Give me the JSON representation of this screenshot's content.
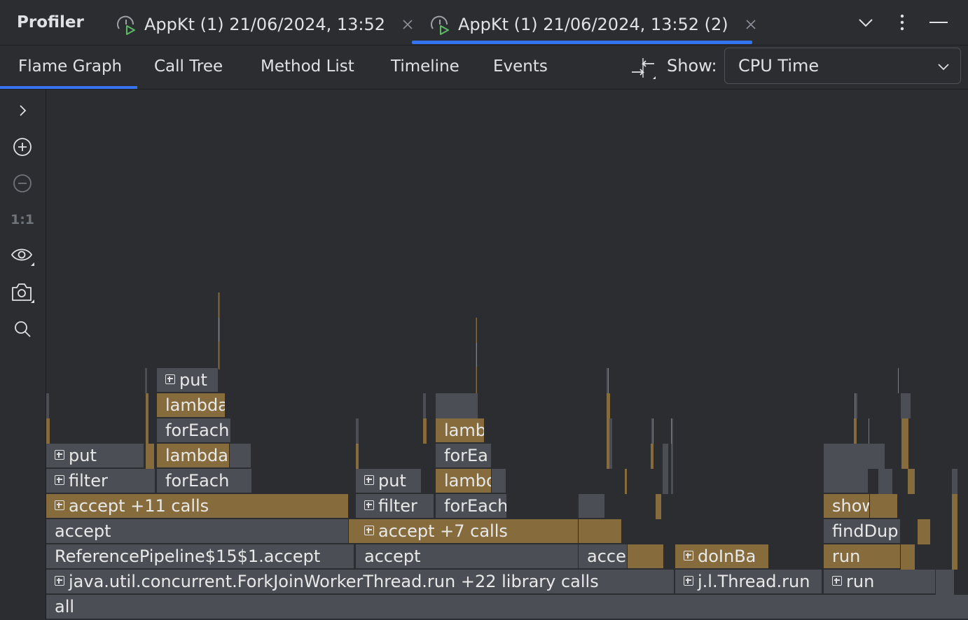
{
  "app_title": "Profiler",
  "tabs": [
    {
      "label": "AppKt (1) 21/06/2024, 13:52",
      "active": false,
      "icon": "profiler-snapshot-icon"
    },
    {
      "label": "AppKt (1) 21/06/2024, 13:52 (2)",
      "active": true,
      "icon": "profiler-snapshot-icon"
    }
  ],
  "window_controls": {
    "dropdown_icon": "chevron-down-icon",
    "more_icon": "more-vertical-icon",
    "minimize_icon": "minimize-icon"
  },
  "view_tabs": [
    {
      "label": "Flame Graph",
      "active": true
    },
    {
      "label": "Call Tree",
      "active": false
    },
    {
      "label": "Method List",
      "active": false
    },
    {
      "label": "Timeline",
      "active": false
    },
    {
      "label": "Events",
      "active": false
    }
  ],
  "show": {
    "label": "Show:",
    "value": "CPU Time"
  },
  "left_toolbar": {
    "expand_icon": "chevron-right-icon",
    "zoom_in_icon": "zoom-in-icon",
    "zoom_out_icon": "zoom-out-icon",
    "reset_zoom": "1:1",
    "view_icon": "eye-icon",
    "capture_icon": "camera-icon",
    "search_icon": "search-icon"
  },
  "colors": {
    "accent": "#3574f0",
    "frame_grey": "#4b4f55",
    "frame_highlight": "#866c3d",
    "background": "#2b2d30"
  },
  "flame": {
    "root": "all",
    "frames": [
      {
        "label": "java.util.concurrent.ForkJoinWorkerThread.run  +22 library calls",
        "collapsed": true
      },
      {
        "label": "j.l.Thread.run",
        "collapsed": true
      },
      {
        "label": "run",
        "collapsed": true
      },
      {
        "label": "ReferencePipeline$15$1.accept",
        "collapsed": false
      },
      {
        "label": "accept",
        "collapsed": false
      },
      {
        "label": "acce",
        "collapsed": false
      },
      {
        "label": "doInBa",
        "collapsed": true
      },
      {
        "label": "run",
        "collapsed": false
      },
      {
        "label": "accept",
        "collapsed": false
      },
      {
        "label": "accept  +7 calls",
        "collapsed": true
      },
      {
        "label": "findDup",
        "collapsed": false
      },
      {
        "label": "accept  +11 calls",
        "collapsed": true
      },
      {
        "label": "filter",
        "collapsed": true
      },
      {
        "label": "forEach",
        "collapsed": false
      },
      {
        "label": "show",
        "collapsed": false
      },
      {
        "label": "filter",
        "collapsed": true
      },
      {
        "label": "forEach",
        "collapsed": false
      },
      {
        "label": "put",
        "collapsed": true
      },
      {
        "label": "lambd",
        "collapsed": false
      },
      {
        "label": "put",
        "collapsed": true
      },
      {
        "label": "lambda",
        "collapsed": false
      },
      {
        "label": "forEa",
        "collapsed": false
      },
      {
        "label": "forEach",
        "collapsed": false
      },
      {
        "label": "lamb",
        "collapsed": false
      },
      {
        "label": "lambda",
        "collapsed": false
      },
      {
        "label": "put",
        "collapsed": true
      }
    ]
  }
}
